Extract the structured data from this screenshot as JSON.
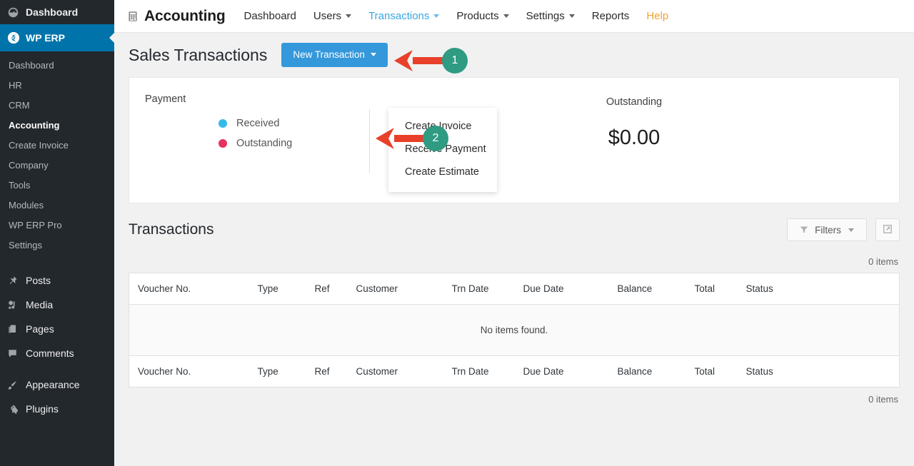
{
  "sidebar": {
    "top_items": [
      {
        "label": "Dashboard",
        "icon": "gauge-icon"
      }
    ],
    "erp": {
      "label": "WP ERP",
      "icon": "wperp-logo-icon"
    },
    "sub_items": [
      {
        "label": "Dashboard",
        "active": false
      },
      {
        "label": "HR",
        "active": false
      },
      {
        "label": "CRM",
        "active": false
      },
      {
        "label": "Accounting",
        "active": true
      },
      {
        "label": "Create Invoice",
        "active": false
      },
      {
        "label": "Company",
        "active": false
      },
      {
        "label": "Tools",
        "active": false
      },
      {
        "label": "Modules",
        "active": false
      },
      {
        "label": "WP ERP Pro",
        "active": false
      },
      {
        "label": "Settings",
        "active": false
      }
    ],
    "menu_items": [
      {
        "label": "Posts",
        "icon": "pin-icon"
      },
      {
        "label": "Media",
        "icon": "media-icon"
      },
      {
        "label": "Pages",
        "icon": "pages-icon"
      },
      {
        "label": "Comments",
        "icon": "comment-icon"
      }
    ],
    "menu_items2": [
      {
        "label": "Appearance",
        "icon": "brush-icon"
      },
      {
        "label": "Plugins",
        "icon": "plug-icon"
      }
    ]
  },
  "header": {
    "brand": "Accounting",
    "brand_icon": "calculator-icon",
    "nav": [
      {
        "label": "Dashboard",
        "caret": false,
        "state": "normal"
      },
      {
        "label": "Users",
        "caret": true,
        "state": "normal"
      },
      {
        "label": "Transactions",
        "caret": true,
        "state": "active"
      },
      {
        "label": "Products",
        "caret": true,
        "state": "normal"
      },
      {
        "label": "Settings",
        "caret": true,
        "state": "normal"
      },
      {
        "label": "Reports",
        "caret": false,
        "state": "normal"
      },
      {
        "label": "Help",
        "caret": false,
        "state": "help"
      }
    ]
  },
  "page": {
    "title": "Sales Transactions",
    "new_transaction_button": "New Transaction"
  },
  "dropdown": {
    "items": [
      {
        "label": "Create Invoice"
      },
      {
        "label": "Receive Payment"
      },
      {
        "label": "Create Estimate"
      }
    ]
  },
  "summary_card": {
    "payment_label": "Payment",
    "legend": [
      {
        "label": "Received",
        "color": "#36b9e8"
      },
      {
        "label": "Outstanding",
        "color": "#e8305e"
      }
    ],
    "outstanding_label": "Outstanding",
    "outstanding_amount": "$0.00"
  },
  "transactions": {
    "title": "Transactions",
    "filters_label": "Filters",
    "export_icon": "export-icon",
    "items_count_top": "0 items",
    "items_count_bottom": "0 items",
    "columns": [
      "Voucher No.",
      "Type",
      "Ref",
      "Customer",
      "Trn Date",
      "Due Date",
      "Balance",
      "Total",
      "Status"
    ],
    "empty_message": "No items found."
  },
  "annotations": [
    {
      "number": "1",
      "target": "new-transaction-button"
    },
    {
      "number": "2",
      "target": "create-estimate-menu-item"
    }
  ],
  "colors": {
    "accent_blue": "#3498db",
    "nav_active": "#38a7e0",
    "help_orange": "#f0a32c",
    "arrow_red": "#e8402a",
    "badge_green": "#2e9b82",
    "sidebar_bg": "#23282d",
    "erp_bg": "#0073aa"
  }
}
